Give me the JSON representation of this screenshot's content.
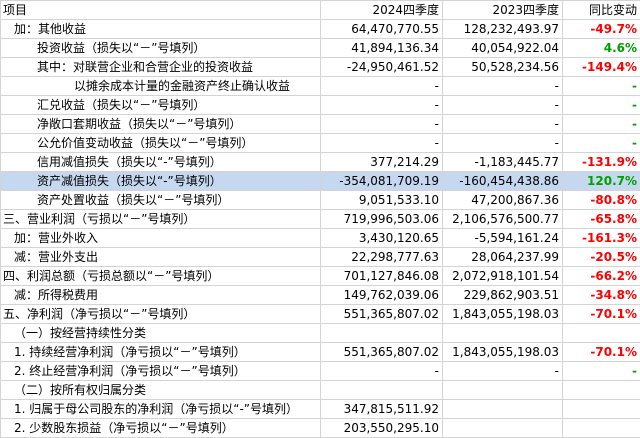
{
  "header": {
    "item": "项目",
    "col_2024": "2024四季度",
    "col_2023": "2023四季度",
    "col_yoy": "同比变动"
  },
  "rows": [
    {
      "label": "加：其他收益",
      "v2024": "64,470,770.55",
      "v2023": "128,232,493.97",
      "yoy": "-49.7%"
    },
    {
      "label": "投资收益（损失以“－”号填列）",
      "v2024": "41,894,136.34",
      "v2023": "40,054,922.04",
      "yoy": "4.6%"
    },
    {
      "label": "其中：对联营企业和合营企业的投资收益",
      "v2024": "-24,950,461.52",
      "v2023": "50,528,234.56",
      "yoy": "-149.4%"
    },
    {
      "label": "以摊余成本计量的金融资产终止确认收益",
      "v2024": "-",
      "v2023": "-",
      "yoy": "-"
    },
    {
      "label": "汇兑收益（损失以“－”号填列）",
      "v2024": "-",
      "v2023": "-",
      "yoy": "-"
    },
    {
      "label": "净敞口套期收益（损失以“－”号填列）",
      "v2024": "-",
      "v2023": "-",
      "yoy": "-"
    },
    {
      "label": "公允价值变动收益（损失以“－”号填列）",
      "v2024": "-",
      "v2023": "-",
      "yoy": "-"
    },
    {
      "label": "信用减值损失（损失以“-”号填列）",
      "v2024": "377,214.29",
      "v2023": "-1,183,445.77",
      "yoy": "-131.9%"
    },
    {
      "label": "资产减值损失（损失以“-”号填列）",
      "v2024": "-354,081,709.19",
      "v2023": "-160,454,438.86",
      "yoy": "120.7%"
    },
    {
      "label": "资产处置收益（损失以“－”号填列）",
      "v2024": "9,051,533.10",
      "v2023": "47,200,867.36",
      "yoy": "-80.8%"
    },
    {
      "label": "三、营业利润（亏损以“－”号填列）",
      "v2024": "719,996,503.06",
      "v2023": "2,106,576,500.77",
      "yoy": "-65.8%"
    },
    {
      "label": "加：营业外收入",
      "v2024": "3,430,120.65",
      "v2023": "-5,594,161.24",
      "yoy": "-161.3%"
    },
    {
      "label": "减：营业外支出",
      "v2024": "22,298,777.63",
      "v2023": "28,064,237.99",
      "yoy": "-20.5%"
    },
    {
      "label": "四、利润总额（亏损总额以“－”号填列）",
      "v2024": "701,127,846.08",
      "v2023": "2,072,918,101.54",
      "yoy": "-66.2%"
    },
    {
      "label": "减：所得税费用",
      "v2024": "149,762,039.06",
      "v2023": "229,862,903.51",
      "yoy": "-34.8%"
    },
    {
      "label": "五、净利润（净亏损以“－”号填列）",
      "v2024": "551,365,807.02",
      "v2023": "1,843,055,198.03",
      "yoy": "-70.1%"
    },
    {
      "label": "（一）按经营持续性分类",
      "v2024": "",
      "v2023": "",
      "yoy": ""
    },
    {
      "label": "1. 持续经营净利润（净亏损以“－”号填列）",
      "v2024": "551,365,807.02",
      "v2023": "1,843,055,198.03",
      "yoy": "-70.1%"
    },
    {
      "label": "2. 终止经营净利润（净亏损以“－”号填列）",
      "v2024": "-",
      "v2023": "-",
      "yoy": "-"
    },
    {
      "label": "（二）按所有权归属分类",
      "v2024": "",
      "v2023": "",
      "yoy": ""
    },
    {
      "label": "1. 归属于母公司股东的净利润（净亏损以“-”号填列）",
      "v2024": "347,815,511.92",
      "v2023": "",
      "yoy": ""
    },
    {
      "label": "2. 少数股东损益（净亏损以“－”号填列）",
      "v2024": "203,550,295.10",
      "v2023": "",
      "yoy": ""
    }
  ],
  "colors": {
    "negative": "#ff0000",
    "positive": "#00a000",
    "highlight_row": "#c6d8ef"
  }
}
